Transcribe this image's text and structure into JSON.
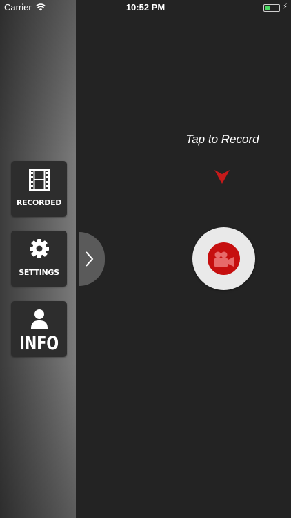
{
  "status_bar": {
    "carrier": "Carrier",
    "time": "10:52 PM",
    "wifi_icon": "wifi-icon",
    "battery_icon": "battery-icon",
    "battery_fill_percent": 40
  },
  "sidebar": {
    "items": [
      {
        "label": "RECORDED",
        "icon": "film-strip-icon"
      },
      {
        "label": "SETTINGS",
        "icon": "gear-icon"
      },
      {
        "label": "INFO",
        "icon": "user-icon"
      }
    ],
    "toggle_icon": "chevron-right-icon"
  },
  "main": {
    "tap_label": "Tap to Record",
    "arrow_icon": "arrow-down-icon",
    "record_icon": "video-camera-icon"
  },
  "colors": {
    "background": "#232323",
    "accent_red": "#c60f0f",
    "battery_green": "#4cd964",
    "tile": "#2d2d2d"
  }
}
